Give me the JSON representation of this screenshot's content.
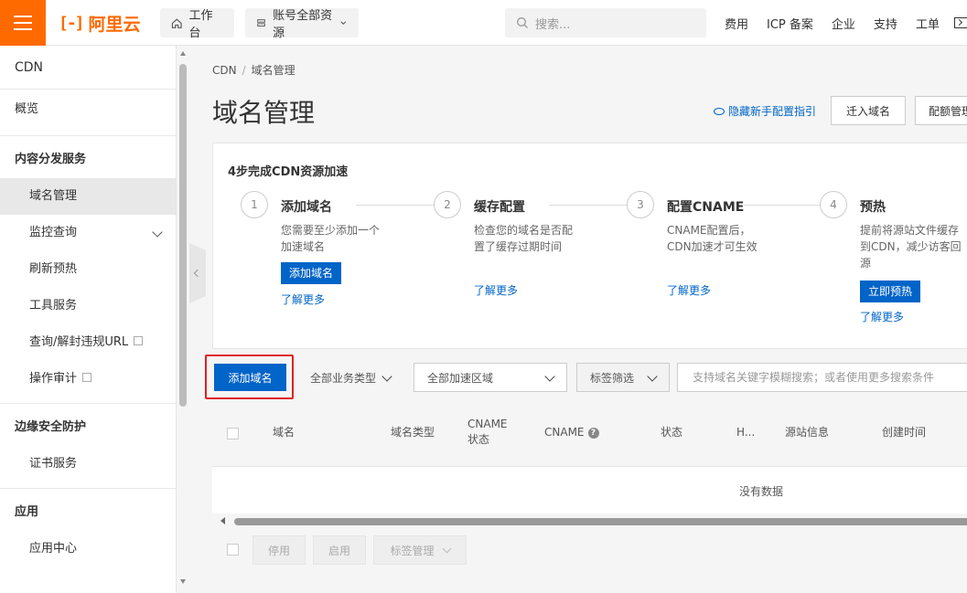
{
  "topbar": {
    "brand": "阿里云",
    "workbench": "工作台",
    "resources": "账号全部资源",
    "search_placeholder": "搜索...",
    "nav": [
      "费用",
      "ICP 备案",
      "企业",
      "支持",
      "工单"
    ]
  },
  "sidebar": {
    "title": "CDN",
    "overview": "概览",
    "groups": [
      {
        "label": "内容分发服务",
        "items": [
          "域名管理",
          "监控查询",
          "刷新预热",
          "工具服务",
          "查询/解封违规URL",
          "操作审计"
        ]
      },
      {
        "label": "边缘安全防护",
        "items": [
          "证书服务"
        ]
      },
      {
        "label": "应用",
        "items": [
          "应用中心"
        ]
      }
    ],
    "active_item": "域名管理"
  },
  "breadcrumb": [
    "CDN",
    "域名管理"
  ],
  "page": {
    "title": "域名管理",
    "guide_link": "隐藏新手配置指引",
    "migrate_button": "迁入域名",
    "quota_button": "配额管理"
  },
  "steps": {
    "title": "4步完成CDN资源加速",
    "items": [
      {
        "num": "1",
        "title": "添加域名",
        "desc": "您需要至少添加一个加速域名",
        "button": "添加域名",
        "link": "了解更多"
      },
      {
        "num": "2",
        "title": "缓存配置",
        "desc": "检查您的域名是否配置了缓存过期时间",
        "link": "了解更多"
      },
      {
        "num": "3",
        "title": "配置CNAME",
        "desc": "CNAME配置后，CDN加速才可生效",
        "link": "了解更多"
      },
      {
        "num": "4",
        "title": "预热",
        "desc": "提前将源站文件缓存到CDN，减少访客回源",
        "button": "立即预热",
        "link": "了解更多"
      }
    ]
  },
  "toolbar": {
    "add_domain": "添加域名",
    "business_type": "全部业务类型",
    "region": "全部加速区域",
    "tag_filter": "标签筛选",
    "search_placeholder": "支持域名关键字模糊搜索；或者使用更多搜索条件"
  },
  "table": {
    "headers": [
      "域名",
      "域名类型",
      "CNAME\n状态",
      "CNAME",
      "状态",
      "H...",
      "源站信息",
      "创建时间"
    ],
    "empty_text": "没有数据"
  },
  "footer": {
    "disable": "停用",
    "enable": "启用",
    "tag_manage": "标签管理"
  },
  "colors": {
    "brand": "#ff6a00",
    "primary": "#0064c8",
    "highlight_box": "#e02020"
  }
}
